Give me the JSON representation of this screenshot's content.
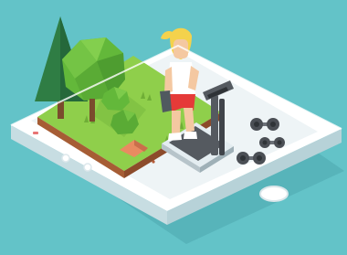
{
  "scene": {
    "subject": "fitness-app-illustration",
    "background_color": "#63c3c8",
    "phone": {
      "body_color": "#ffffff",
      "side_color": "#d6e6ea",
      "screen_color": "#eef4f6"
    },
    "nature": {
      "grass_color": "#8fcf4b",
      "grass_dark_color": "#6fae36",
      "soil_color": "#a65d35",
      "tree_color": "#5faa3a",
      "pine_color": "#2f7d44"
    },
    "person": {
      "hair_color": "#f4d24c",
      "shirt_color": "#ffffff",
      "shorts_color": "#e53a38",
      "skin_color": "#f4c8a1"
    },
    "equipment": {
      "treadmill_color": "#555a60",
      "dumbbell_color": "#4b4f55"
    }
  }
}
